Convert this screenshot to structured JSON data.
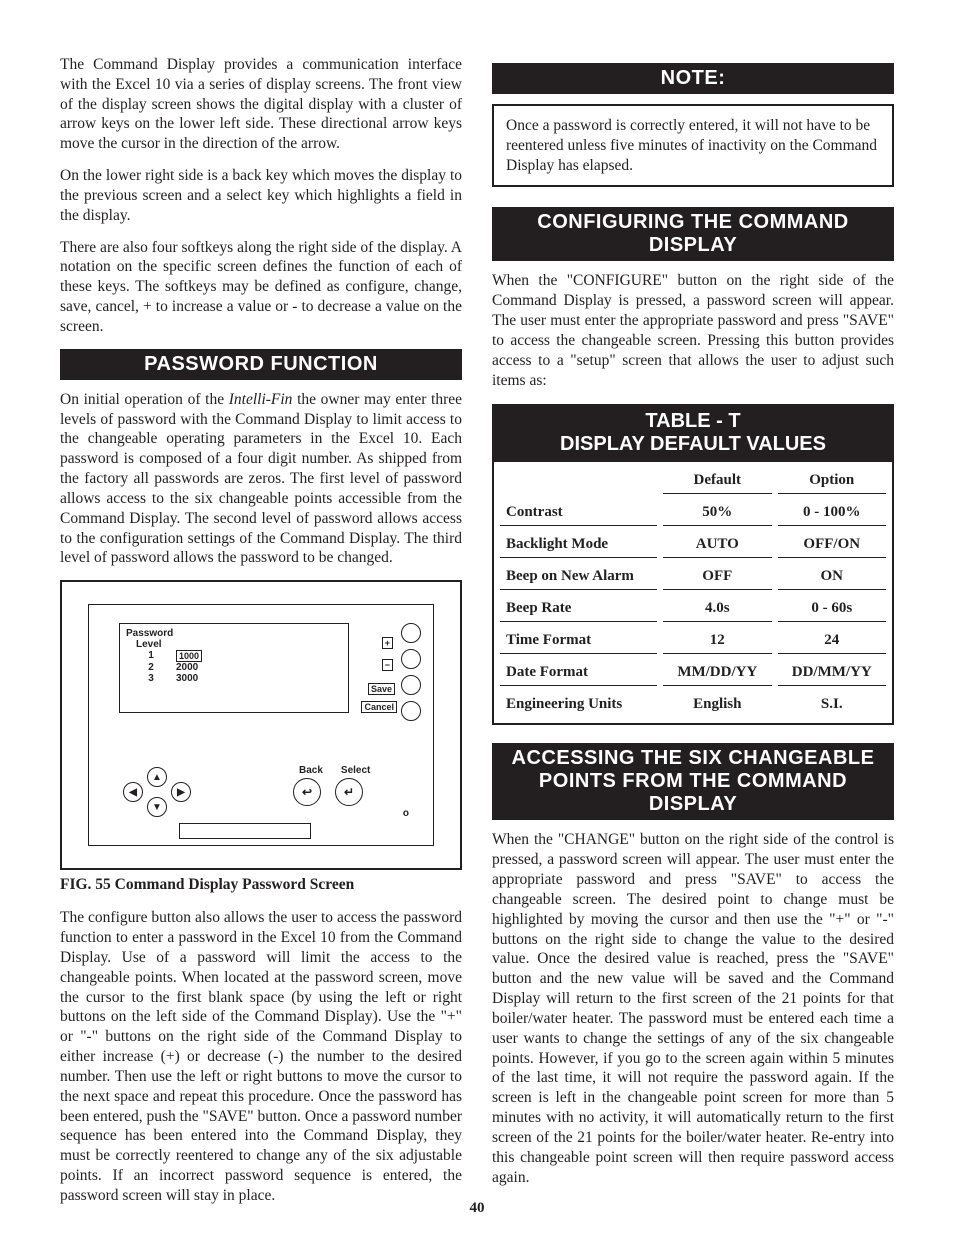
{
  "page_number": "40",
  "left": {
    "p1": "The Command Display provides a communication interface with the Excel 10 via a series of display screens.  The front view of the display screen shows the digital display with a cluster of arrow keys on the lower left side.  These directional arrow keys move the cursor in the direction of the arrow.",
    "p2": "On the lower right side is a back key which moves the display to the previous screen and a select key which highlights a field in the display.",
    "p3": "There are also four softkeys along the right side of the display.  A notation on the specific screen defines the function of each of these keys.  The softkeys may be defined as configure, change, save, cancel, + to increase a value or - to decrease a value on the screen.",
    "h_password": "PASSWORD FUNCTION",
    "p4a": "On initial operation of the ",
    "p4b": "Intelli-Fin",
    "p4c": " the owner may enter three levels of password with the Command Display to limit access to the changeable operating parameters in the Excel 10.  Each password is composed of a four digit number.  As shipped from the factory all passwords are zeros.  The first level of password allows access to the six changeable points accessible from the Command Display.  The second level of password allows access to the configuration settings of the Command Display.  The third level of password allows the password to be changed.",
    "fig_caption": "FIG. 55   Command Display Password Screen",
    "p5": "The configure button also allows the user to access the password function to enter a password in the  Excel 10 from the Command Display.  Use of a password will limit the access to the changeable points. When located at the password screen, move the cursor to the first blank space (by using the left or right buttons on the left side of the Command Display).  Use the \"+\" or \"-\" buttons on the right side of the Command Display to either increase (+) or decrease (-) the number to the desired number.  Then use the left or right buttons to move the cursor to the next space and repeat this procedure.  Once the password has been entered, push the \"SAVE\" button. Once a password number sequence has been entered into the Command Display, they must be correctly reentered to change any of the six adjustable points.  If an incorrect password sequence is entered, the password screen will stay in place."
  },
  "fig55": {
    "lcd_title": "Password",
    "lcd_sub": "Level",
    "rows": [
      {
        "lv": "1",
        "val": "1000",
        "boxed": true
      },
      {
        "lv": "2",
        "val": "2000",
        "boxed": false
      },
      {
        "lv": "3",
        "val": "3000",
        "boxed": false
      }
    ],
    "sk_plus": "+",
    "sk_minus": "−",
    "sk_save": "Save",
    "sk_cancel": "Cancel",
    "back": "Back",
    "select": "Select",
    "contrast": "o"
  },
  "right": {
    "h_note": "NOTE:",
    "note_text": "Once a password is correctly entered, it will not have to be reentered unless five minutes of inactivity on the Command Display has elapsed.",
    "h_config": "CONFIGURING THE COMMAND DISPLAY",
    "p_config": "When the \"CONFIGURE\" button on the right side of the Command Display is pressed, a password screen will appear.  The user must enter the appropriate password and press \"SAVE\" to access the changeable screen.  Pressing this button provides access to a \"setup\" screen that allows the user to adjust such items as:",
    "table_title_1": "TABLE - T",
    "table_title_2": "DISPLAY DEFAULT VALUES",
    "table": {
      "head": [
        "",
        "Default",
        "Option"
      ],
      "rows": [
        [
          "Contrast",
          "50%",
          "0 - 100%"
        ],
        [
          "Backlight Mode",
          "AUTO",
          "OFF/ON"
        ],
        [
          "Beep on New Alarm",
          "OFF",
          "ON"
        ],
        [
          "Beep Rate",
          "4.0s",
          "0 - 60s"
        ],
        [
          "Time Format",
          "12",
          "24"
        ],
        [
          "Date Format",
          "MM/DD/YY",
          "DD/MM/YY"
        ],
        [
          "Engineering Units",
          "English",
          "S.I."
        ]
      ]
    },
    "h_access": "ACCESSING THE SIX CHANGEABLE POINTS FROM THE COMMAND DISPLAY",
    "p_access": "When the \"CHANGE\" button on the right side of the control is pressed, a password screen will appear.  The user must enter the appropriate password and press \"SAVE\" to access the changeable screen.  The desired point to change must be highlighted by moving the cursor and then use the \"+\" or \"-\" buttons on the right side to change the value to the desired value.  Once the desired value is reached, press the \"SAVE\" button and the new value will be saved and the Command Display will return to the first screen of the 21 points for that boiler/water heater.  The password must be entered each time a user wants to change the settings of any of the six changeable points.  However, if you go to the screen again within 5 minutes of the last time, it will not require the password again.  If the screen is left in the changeable point screen for more than 5 minutes with no activity, it will automatically return to the first screen of the 21 points for the boiler/water heater.  Re-entry into this changeable point screen will then require password access again."
  }
}
